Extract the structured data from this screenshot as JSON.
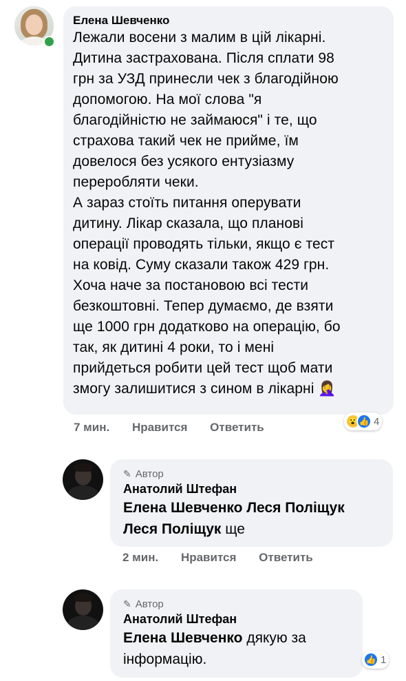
{
  "comment": {
    "author": "Елена Шевченко",
    "text": "Лежали восени з малим в цій лікарні.\nДитина застрахована. Після сплати 98\nгрн за УЗД принесли чек з благодійною\nдопомогою. На мої слова \"я\nблагодійністю не займаюся\" і те, що\nстрахова такий чек не прийме, їм\nдовелося без усякого ентузіазму\nпереробляти чеки.\nА зараз стоїть питання оперувати\nдитину. Лікар сказала, що планові\nоперації проводять тільки, якщо є тест\nна ковід. Суму сказали також 429 грн.\nХоча наче за постановою всі тести\nбезкоштовні. Тепер думаємо, де взяти\nще 1000 грн додатково на операцію, бо\nтак, як дитині 4 роки, то і мені\nприйдеться робити цей тест щоб мати\nзмогу залишитися з сином в лікарні",
    "emoji": "🤦‍♀️",
    "time": "7 мин.",
    "like_label": "Нравится",
    "reply_label": "Ответить",
    "reactions": {
      "icons": [
        "wow-icon",
        "like-icon"
      ],
      "count": "4"
    }
  },
  "replies": [
    {
      "badge": "Автор",
      "author": "Анатолий Штефан",
      "mention1": "Елена Шевченко",
      "mention2": "Леся Поліщук",
      "mention3": "Леся Поліщук",
      "text": "ще",
      "time": "2 мин.",
      "like_label": "Нравится",
      "reply_label": "Ответить"
    },
    {
      "badge": "Автор",
      "author": "Анатолий Штефан",
      "mention1": "Елена Шевченко",
      "text_line1": "дякую за",
      "text_line2": "інформацію.",
      "reactions": {
        "icons": [
          "like-icon"
        ],
        "count": "1"
      }
    }
  ],
  "colors": {
    "bubble": "#f0f2f5",
    "meta": "#65676b",
    "online": "#31a24c",
    "like": "#1877f2"
  }
}
